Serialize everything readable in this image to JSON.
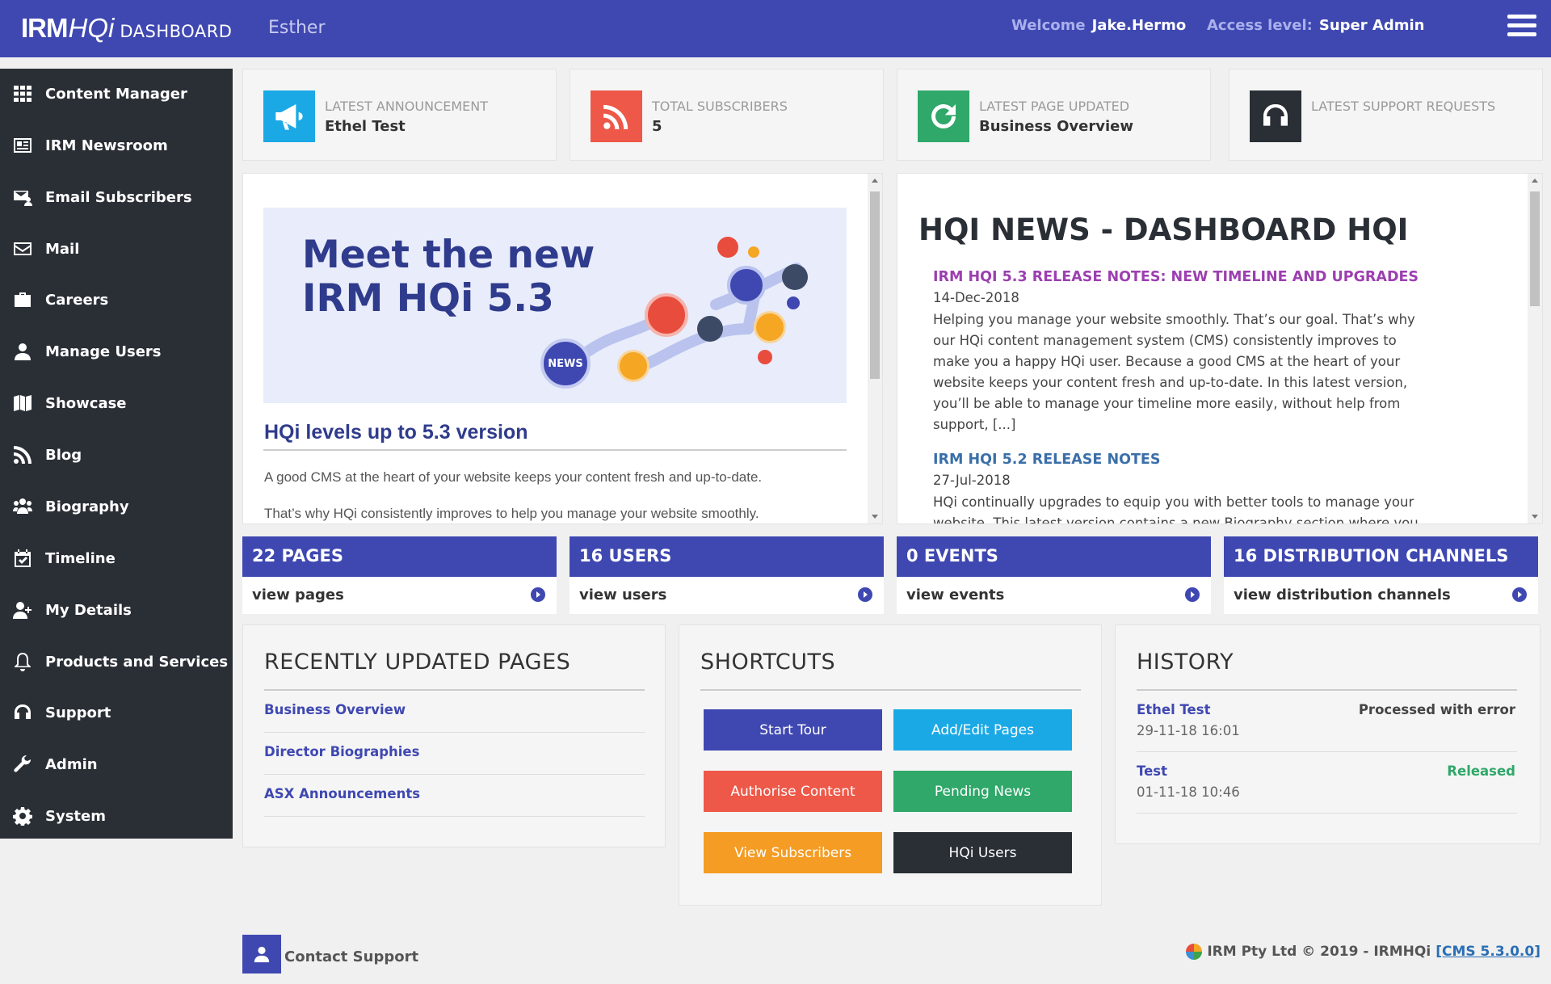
{
  "header": {
    "logo_irm": "IRM",
    "logo_hqi": "HQi",
    "logo_dashboard": "DASHBOARD",
    "site_name": "Esther",
    "welcome_label": "Welcome",
    "welcome_user": "Jake.Hermo",
    "access_label": "Access level:",
    "access_value": "Super Admin"
  },
  "sidebar": {
    "items": [
      {
        "label": "Content Manager",
        "icon": "grid-icon"
      },
      {
        "label": "IRM Newsroom",
        "icon": "newspaper-icon"
      },
      {
        "label": "Email Subscribers",
        "icon": "envelope-user-icon"
      },
      {
        "label": "Mail",
        "icon": "envelope-icon"
      },
      {
        "label": "Careers",
        "icon": "briefcase-icon"
      },
      {
        "label": "Manage Users",
        "icon": "user-icon"
      },
      {
        "label": "Showcase",
        "icon": "map-icon"
      },
      {
        "label": "Blog",
        "icon": "rss-icon"
      },
      {
        "label": "Biography",
        "icon": "users-icon"
      },
      {
        "label": "Timeline",
        "icon": "calendar-check-icon"
      },
      {
        "label": "My Details",
        "icon": "user-plus-icon"
      },
      {
        "label": "Products and Services",
        "icon": "bell-icon"
      },
      {
        "label": "Support",
        "icon": "headphones-icon"
      },
      {
        "label": "Admin",
        "icon": "wrench-icon"
      },
      {
        "label": "System",
        "icon": "gear-icon"
      }
    ]
  },
  "stats": [
    {
      "label": "LATEST ANNOUNCEMENT",
      "value": "Ethel Test",
      "icon": "megaphone-icon",
      "color": "#1ba9e6"
    },
    {
      "label": "TOTAL SUBSCRIBERS",
      "value": "5",
      "icon": "rss-icon",
      "color": "#ee5848"
    },
    {
      "label": "LATEST PAGE UPDATED",
      "value": "Business Overview",
      "icon": "refresh-icon",
      "color": "#2fa86a"
    },
    {
      "label": "LATEST SUPPORT REQUESTS",
      "value": "",
      "icon": "headphones-icon",
      "color": "#2a2f36"
    }
  ],
  "promo": {
    "banner_line1": "Meet the new",
    "banner_line2": "IRM HQi 5.3",
    "banner_badge": "NEWS",
    "title": "HQi levels up to 5.3 version",
    "para1": "A good CMS at the heart of your website keeps your content fresh and up-to-date.",
    "para2": "That’s why HQi consistently improves to help you manage your website smoothly."
  },
  "news": {
    "heading": "HQI NEWS - DASHBOARD HQI",
    "items": [
      {
        "title": "IRM HQI 5.3 RELEASE NOTES: NEW TIMELINE AND UPGRADES",
        "date": "14-Dec-2018",
        "lines": [
          "Helping you manage your website smoothly. That’s our goal. That’s why",
          "our HQi content management system (CMS) consistently improves to",
          "make you a happy HQi user. Because a good CMS at the heart of your",
          "website keeps your content fresh and up-to-date. In this latest version,",
          "you’ll be able to manage your timeline more easily, without help from",
          "support, [...]"
        ]
      },
      {
        "title": "IRM HQI 5.2 RELEASE NOTES",
        "date": "27-Jul-2018",
        "lines": [
          "HQi continually upgrades to equip you with better tools to manage your",
          "website. This latest version contains a new Biography section where you"
        ]
      }
    ]
  },
  "counts": [
    {
      "heading": "22 PAGES",
      "link": "view pages"
    },
    {
      "heading": "16 USERS",
      "link": "view users"
    },
    {
      "heading": "0 EVENTS",
      "link": "view events"
    },
    {
      "heading": "16 DISTRIBUTION CHANNELS",
      "link": "view distribution channels"
    }
  ],
  "recent": {
    "title": "RECENTLY UPDATED PAGES",
    "items": [
      "Business Overview",
      "Director Biographies",
      "ASX Announcements"
    ]
  },
  "shortcuts": {
    "title": "SHORTCUTS",
    "buttons": [
      {
        "label": "Start Tour",
        "color": "#3f48b1"
      },
      {
        "label": "Add/Edit Pages",
        "color": "#1ba9e6"
      },
      {
        "label": "Authorise Content",
        "color": "#ee5848"
      },
      {
        "label": "Pending News",
        "color": "#2fa86a"
      },
      {
        "label": "View Subscribers",
        "color": "#f49c23"
      },
      {
        "label": "HQi Users",
        "color": "#2a2f36"
      }
    ]
  },
  "history": {
    "title": "HISTORY",
    "items": [
      {
        "name": "Ethel Test",
        "date": "29-11-18 16:01",
        "status": "Processed with error",
        "status_color": "#444444"
      },
      {
        "name": "Test",
        "date": "01-11-18 10:46",
        "status": "Released",
        "status_color": "#2fa86a"
      }
    ]
  },
  "footer": {
    "contact_label": "Contact Support",
    "copyright": "IRM Pty Ltd © 2019 - IRMHQi",
    "version": "[CMS 5.3.0.0]"
  }
}
